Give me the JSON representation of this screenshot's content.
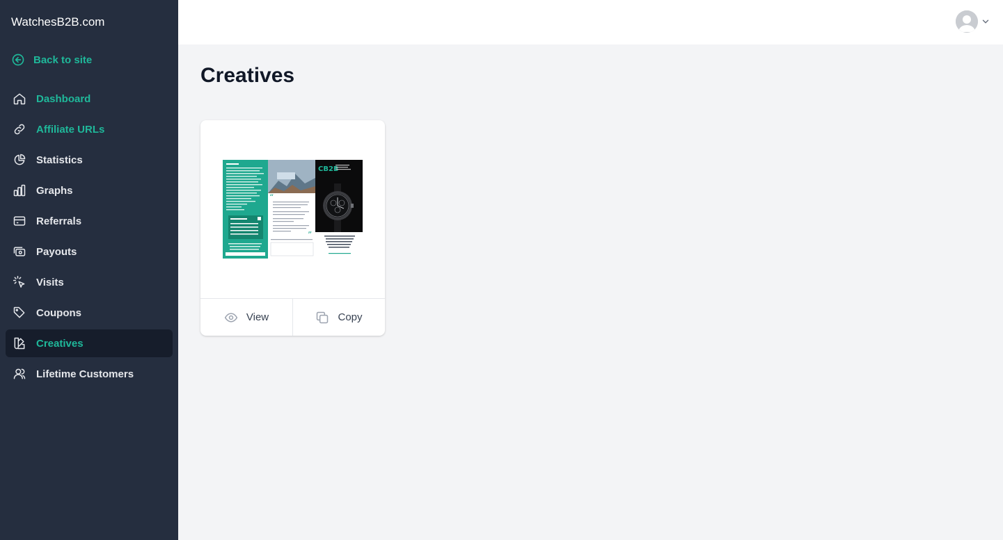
{
  "brand": "WatchesB2B.com",
  "back_link": {
    "label": "Back to site",
    "icon": "arrow-left-circle-icon"
  },
  "nav": [
    {
      "label": "Dashboard",
      "icon": "home-icon",
      "state": "accent"
    },
    {
      "label": "Affiliate URLs",
      "icon": "link-icon",
      "state": "accent"
    },
    {
      "label": "Statistics",
      "icon": "pie-chart-icon",
      "state": "default"
    },
    {
      "label": "Graphs",
      "icon": "bar-chart-icon",
      "state": "default"
    },
    {
      "label": "Referrals",
      "icon": "credit-card-icon",
      "state": "default"
    },
    {
      "label": "Payouts",
      "icon": "cash-icon",
      "state": "default"
    },
    {
      "label": "Visits",
      "icon": "cursor-click-icon",
      "state": "default"
    },
    {
      "label": "Coupons",
      "icon": "tag-icon",
      "state": "default"
    },
    {
      "label": "Creatives",
      "icon": "swatch-icon",
      "state": "active"
    },
    {
      "label": "Lifetime Customers",
      "icon": "users-icon",
      "state": "default"
    }
  ],
  "page": {
    "title": "Creatives"
  },
  "creative_card": {
    "preview_alt": "Watch brochure creative",
    "view_label": "View",
    "copy_label": "Copy"
  },
  "colors": {
    "sidebar_bg": "#252e3f",
    "active_bg": "#161d2b",
    "accent": "#1fb89a",
    "page_bg": "#f3f4f6"
  }
}
